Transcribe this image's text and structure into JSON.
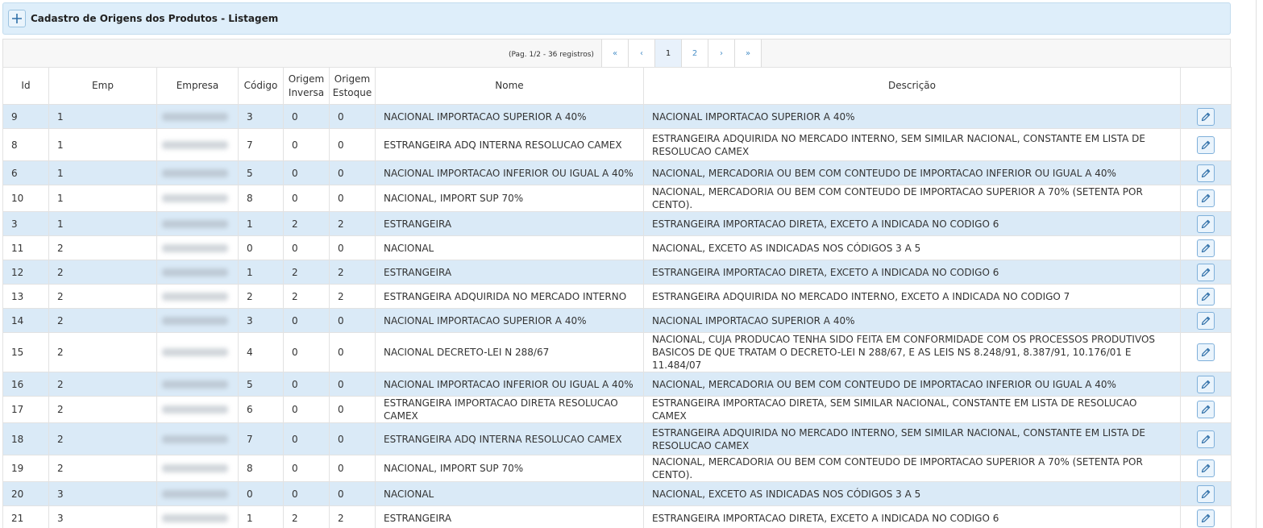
{
  "header": {
    "title": "Cadastro de Origens dos Produtos - Listagem",
    "add_icon": "plus-icon"
  },
  "pagination": {
    "info": "(Pag. 1/2 - 36 registros)",
    "first": "«",
    "prev": "‹",
    "pages": [
      "1",
      "2"
    ],
    "current": "1",
    "next": "›",
    "last": "»"
  },
  "table": {
    "columns": {
      "id": "Id",
      "emp": "Emp",
      "empresa": "Empresa",
      "codigo": "Código",
      "origem_inversa_1": "Origem",
      "origem_inversa_2": "Inversa",
      "origem_estoque_1": "Origem",
      "origem_estoque_2": "Estoque",
      "nome": "Nome",
      "descricao": "Descrição"
    },
    "rows": [
      {
        "id": "9",
        "emp": "1",
        "codigo": "3",
        "inv": "0",
        "est": "0",
        "nome": "NACIONAL IMPORTACAO SUPERIOR A 40%",
        "desc": "NACIONAL IMPORTACAO SUPERIOR A 40%"
      },
      {
        "id": "8",
        "emp": "1",
        "codigo": "7",
        "inv": "0",
        "est": "0",
        "nome": "ESTRANGEIRA ADQ INTERNA RESOLUCAO CAMEX",
        "desc": "ESTRANGEIRA ADQUIRIDA NO MERCADO INTERNO, SEM SIMILAR NACIONAL, CONSTANTE EM LISTA DE RESOLUCAO CAMEX"
      },
      {
        "id": "6",
        "emp": "1",
        "codigo": "5",
        "inv": "0",
        "est": "0",
        "nome": "NACIONAL IMPORTACAO INFERIOR OU IGUAL A 40%",
        "desc": "NACIONAL, MERCADORIA OU BEM COM CONTEUDO DE IMPORTACAO INFERIOR OU IGUAL A 40%"
      },
      {
        "id": "10",
        "emp": "1",
        "codigo": "8",
        "inv": "0",
        "est": "0",
        "nome": "NACIONAL, IMPORT SUP 70%",
        "desc": "NACIONAL, MERCADORIA OU BEM COM CONTEUDO DE IMPORTACAO SUPERIOR A 70% (SETENTA POR CENTO)."
      },
      {
        "id": "3",
        "emp": "1",
        "codigo": "1",
        "inv": "2",
        "est": "2",
        "nome": "ESTRANGEIRA",
        "desc": "ESTRANGEIRA IMPORTACAO DIRETA, EXCETO A INDICADA NO CODIGO 6"
      },
      {
        "id": "11",
        "emp": "2",
        "codigo": "0",
        "inv": "0",
        "est": "0",
        "nome": "NACIONAL",
        "desc": "NACIONAL, EXCETO AS INDICADAS NOS CÓDIGOS 3 A 5"
      },
      {
        "id": "12",
        "emp": "2",
        "codigo": "1",
        "inv": "2",
        "est": "2",
        "nome": "ESTRANGEIRA",
        "desc": "ESTRANGEIRA IMPORTACAO DIRETA, EXCETO A INDICADA NO CODIGO 6"
      },
      {
        "id": "13",
        "emp": "2",
        "codigo": "2",
        "inv": "2",
        "est": "2",
        "nome": "ESTRANGEIRA ADQUIRIDA NO MERCADO INTERNO",
        "desc": "ESTRANGEIRA ADQUIRIDA NO MERCADO INTERNO, EXCETO A INDICADA NO CODIGO 7"
      },
      {
        "id": "14",
        "emp": "2",
        "codigo": "3",
        "inv": "0",
        "est": "0",
        "nome": "NACIONAL IMPORTACAO SUPERIOR A 40%",
        "desc": "NACIONAL IMPORTACAO SUPERIOR A 40%"
      },
      {
        "id": "15",
        "emp": "2",
        "codigo": "4",
        "inv": "0",
        "est": "0",
        "nome": "NACIONAL DECRETO-LEI N 288/67",
        "desc": "NACIONAL, CUJA PRODUCAO TENHA SIDO FEITA EM CONFORMIDADE COM OS PROCESSOS PRODUTIVOS BASICOS DE QUE TRATAM O DECRETO-LEI N 288/67, E AS LEIS NS 8.248/91, 8.387/91, 10.176/01 E 11.484/07"
      },
      {
        "id": "16",
        "emp": "2",
        "codigo": "5",
        "inv": "0",
        "est": "0",
        "nome": "NACIONAL IMPORTACAO INFERIOR OU IGUAL A 40%",
        "desc": "NACIONAL, MERCADORIA OU BEM COM CONTEUDO DE IMPORTACAO INFERIOR OU IGUAL A 40%"
      },
      {
        "id": "17",
        "emp": "2",
        "codigo": "6",
        "inv": "0",
        "est": "0",
        "nome": "ESTRANGEIRA IMPORTACAO DIRETA RESOLUCAO CAMEX",
        "desc": "ESTRANGEIRA IMPORTACAO DIRETA, SEM SIMILAR NACIONAL, CONSTANTE EM LISTA DE RESOLUCAO CAMEX"
      },
      {
        "id": "18",
        "emp": "2",
        "codigo": "7",
        "inv": "0",
        "est": "0",
        "nome": "ESTRANGEIRA ADQ INTERNA RESOLUCAO CAMEX",
        "desc": "ESTRANGEIRA ADQUIRIDA NO MERCADO INTERNO, SEM SIMILAR NACIONAL, CONSTANTE EM LISTA DE RESOLUCAO CAMEX"
      },
      {
        "id": "19",
        "emp": "2",
        "codigo": "8",
        "inv": "0",
        "est": "0",
        "nome": "NACIONAL, IMPORT SUP 70%",
        "desc": "NACIONAL, MERCADORIA OU BEM COM CONTEUDO DE IMPORTACAO SUPERIOR A 70% (SETENTA POR CENTO)."
      },
      {
        "id": "20",
        "emp": "3",
        "codigo": "0",
        "inv": "0",
        "est": "0",
        "nome": "NACIONAL",
        "desc": "NACIONAL, EXCETO AS INDICADAS NOS CÓDIGOS 3 A 5"
      },
      {
        "id": "21",
        "emp": "3",
        "codigo": "1",
        "inv": "2",
        "est": "2",
        "nome": "ESTRANGEIRA",
        "desc": "ESTRANGEIRA IMPORTACAO DIRETA, EXCETO A INDICADA NO CODIGO 6"
      }
    ]
  },
  "icons": {
    "edit": "pencil-icon"
  },
  "colors": {
    "header_bg": "#deeefa",
    "row_alt": "#daeaf7",
    "accent": "#4a90c8"
  }
}
